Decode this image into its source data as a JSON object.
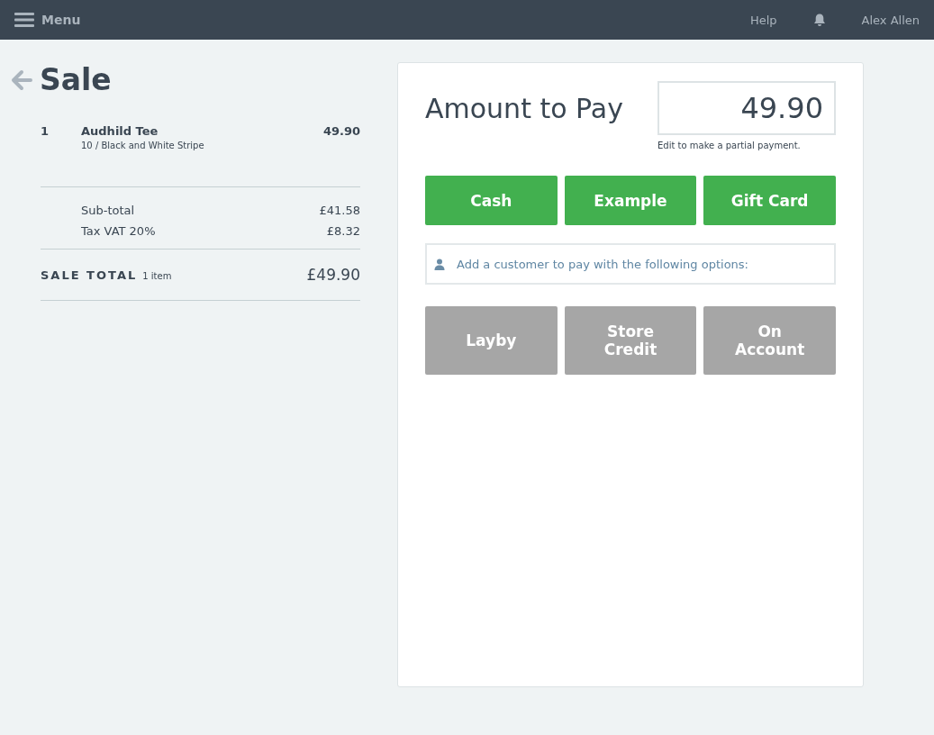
{
  "topbar": {
    "menu_label": "Menu",
    "help": "Help",
    "user": "Alex Allen"
  },
  "sale": {
    "title": "Sale",
    "items": [
      {
        "qty": "1",
        "name": "Audhild Tee",
        "variant": "10 / Black and White Stripe",
        "price": "49.90"
      }
    ],
    "totals": [
      {
        "label": "Sub-total",
        "value": "£41.58"
      },
      {
        "label": "Tax VAT 20%",
        "value": "£8.32"
      }
    ],
    "sale_total": {
      "label": "SALE TOTAL",
      "count": "1 item",
      "value": "£49.90"
    }
  },
  "payment": {
    "title": "Amount to Pay",
    "amount": "49.90",
    "hint": "Edit to make a partial payment.",
    "methods": [
      {
        "label": "Cash",
        "disabled": false
      },
      {
        "label": "Example",
        "disabled": false
      },
      {
        "label": "Gift Card",
        "disabled": false
      }
    ],
    "customer_prompt": "Add a customer to pay with the following options:",
    "customer_methods": [
      {
        "label": "Layby",
        "disabled": true
      },
      {
        "label": "Store Credit",
        "disabled": true
      },
      {
        "label": "On Account",
        "disabled": true
      }
    ]
  }
}
